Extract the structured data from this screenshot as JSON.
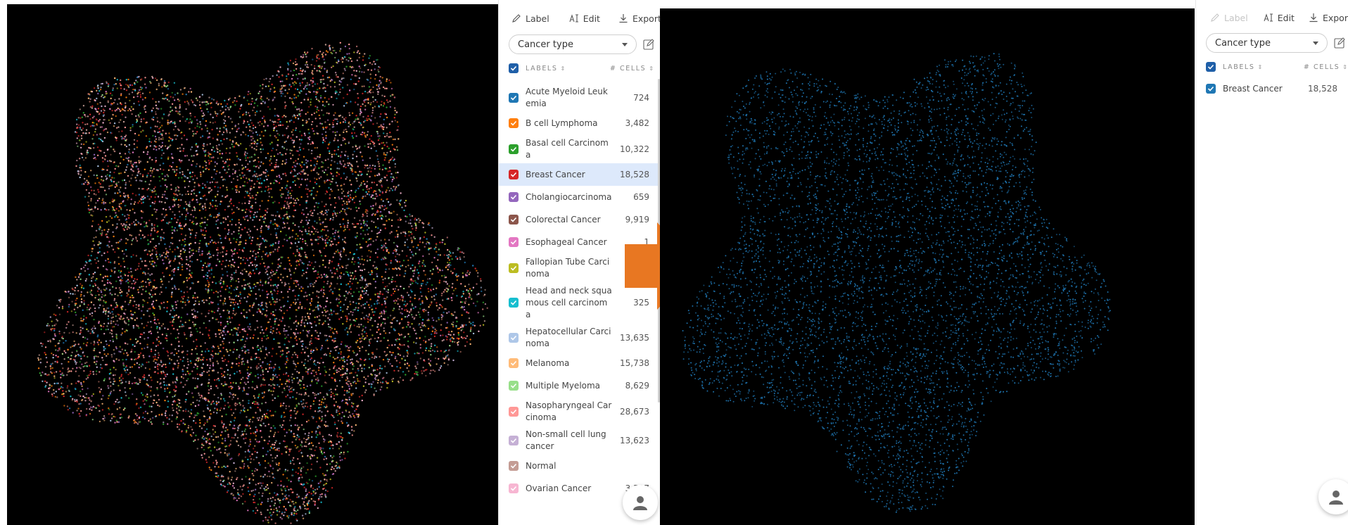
{
  "colors": {
    "scatter_bg": "#000000",
    "arrow": "#e87722",
    "checkbox_blue": "#1f5fa8",
    "breast_cancer_points": "#1f77b4",
    "selected_row": "#dde9fb"
  },
  "left_panel": {
    "toolbar": {
      "label": "Label",
      "label_icon": "pen-icon",
      "edit": "Edit",
      "edit_icon": "text-cursor-icon",
      "export": "Export",
      "export_icon": "download-icon"
    },
    "select_value": "Cancer type",
    "header": {
      "labels": "LABELS",
      "cells": "# CELLS"
    },
    "rows": [
      {
        "name": "Acute Myeloid Leuk\nemia",
        "count": "724",
        "color": "#1f77b4"
      },
      {
        "name": "B cell Lymphoma",
        "count": "3,482",
        "color": "#ff7f0e"
      },
      {
        "name": "Basal cell Carcinom\na",
        "count": "10,322",
        "color": "#2ca02c"
      },
      {
        "name": "Breast Cancer",
        "count": "18,528",
        "color": "#d62728"
      },
      {
        "name": "Cholangiocarcinoma",
        "count": "659",
        "color": "#9467bd"
      },
      {
        "name": "Colorectal Cancer",
        "count": "9,919",
        "color": "#8c564b"
      },
      {
        "name": "Esophageal Cancer",
        "count": "1",
        "color": "#e377c2"
      },
      {
        "name": "Fallopian Tube Carci\nnoma",
        "count": "",
        "color": "#bcbd22"
      },
      {
        "name": "Head and neck squa\nmous cell carcinom\na",
        "count": "325",
        "color": "#17becf"
      },
      {
        "name": "Hepatocellular Carci\nnoma",
        "count": "13,635",
        "color": "#aec7e8"
      },
      {
        "name": "Melanoma",
        "count": "15,738",
        "color": "#ffbb78"
      },
      {
        "name": "Multiple Myeloma",
        "count": "8,629",
        "color": "#98df8a"
      },
      {
        "name": "Nasopharyngeal Car\ncinoma",
        "count": "28,673",
        "color": "#ff9896"
      },
      {
        "name": "Non-small cell lung\ncancer",
        "count": "13,623",
        "color": "#c5b0d5"
      },
      {
        "name": "Normal",
        "count": "",
        "color": "#c49c94"
      },
      {
        "name": "Ovarian Cancer",
        "count": "3,517",
        "color": "#f7b6d2"
      }
    ]
  },
  "right_panel": {
    "toolbar": {
      "label": "Label",
      "label_icon": "pen-icon",
      "edit": "Edit",
      "edit_icon": "text-cursor-icon",
      "export": "Export",
      "export_icon": "download-icon"
    },
    "select_value": "Cancer type",
    "header": {
      "labels": "LABELS",
      "cells": "# CELLS"
    },
    "rows": [
      {
        "name": "Breast Cancer",
        "count": "18,528",
        "color": "#1f77b4"
      }
    ]
  },
  "user_fab_icon": "user-icon",
  "arrow_icon": "right-arrow-icon"
}
